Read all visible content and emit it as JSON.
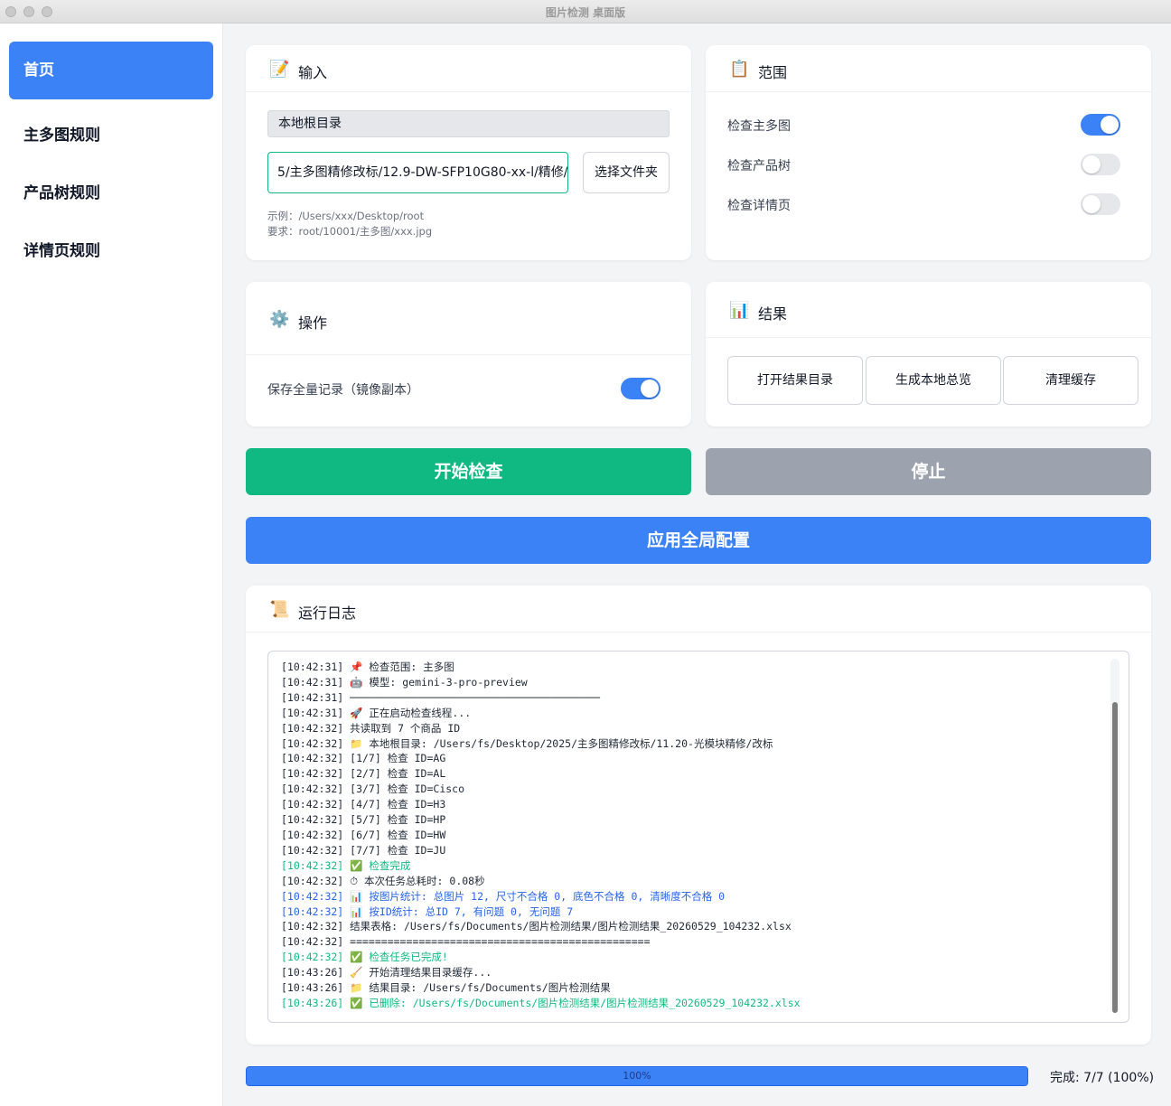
{
  "window": {
    "title": "图片检测 桌面版"
  },
  "sidebar": {
    "items": [
      {
        "label": "首页",
        "active": true
      },
      {
        "label": "主多图规则"
      },
      {
        "label": "产品树规则"
      },
      {
        "label": "详情页规则"
      }
    ]
  },
  "input_card": {
    "icon": "memo-icon",
    "title": "输入",
    "root_label": "本地根目录",
    "path_value": "5/主多图精修改标/12.9-DW-SFP10G80-xx-l/精修/",
    "choose_button": "选择文件夹",
    "hint_example": "示例：/Users/xxx/Desktop/root",
    "hint_requirement": "要求：root/10001/主多图/xxx.jpg"
  },
  "scope_card": {
    "icon": "clipboard-icon",
    "title": "范围",
    "options": [
      {
        "label": "检查主多图",
        "on": true
      },
      {
        "label": "检查产品树",
        "on": false
      },
      {
        "label": "检查详情页",
        "on": false
      }
    ]
  },
  "operation_card": {
    "icon": "gear-icon",
    "title": "操作",
    "save_all_label": "保存全量记录（镜像副本）",
    "save_all_on": true
  },
  "result_card": {
    "icon": "bar-chart-icon",
    "title": "结果",
    "open_dir_button": "打开结果目录",
    "generate_overview_button": "生成本地总览",
    "clear_cache_button": "清理缓存"
  },
  "actions": {
    "start_button": "开始检查",
    "stop_button": "停止",
    "apply_button": "应用全局配置"
  },
  "colors": {
    "start": "#10b981",
    "stop": "#9ca3af",
    "apply": "#3b82f6",
    "accent": "#3b82f6",
    "log_success": "#10b981",
    "log_stats": "#2563eb"
  },
  "log_card": {
    "icon": "scroll-icon",
    "title": "运行日志",
    "lines": [
      {
        "text": "[10:42:31] 📌 检查范围: 主多图"
      },
      {
        "text": "[10:42:31] 🤖 模型: gemini-3-pro-preview"
      },
      {
        "text": "[10:42:31] ────────────────────────────────────────"
      },
      {
        "text": "[10:42:31] 🚀 正在启动检查线程..."
      },
      {
        "text": "[10:42:32] 共读取到 7 个商品 ID"
      },
      {
        "text": "[10:42:32] 📁 本地根目录: /Users/fs/Desktop/2025/主多图精修改标/11.20-光模块精修/改标"
      },
      {
        "text": "[10:42:32] [1/7] 检查 ID=AG"
      },
      {
        "text": "[10:42:32] [2/7] 检查 ID=AL"
      },
      {
        "text": "[10:42:32] [3/7] 检查 ID=Cisco"
      },
      {
        "text": "[10:42:32] [4/7] 检查 ID=H3"
      },
      {
        "text": "[10:42:32] [5/7] 检查 ID=HP"
      },
      {
        "text": "[10:42:32] [6/7] 检查 ID=HW"
      },
      {
        "text": "[10:42:32] [7/7] 检查 ID=JU"
      },
      {
        "text": "[10:42:32] ✅ 检查完成",
        "color": "green"
      },
      {
        "text": "[10:42:32] ⏱ 本次任务总耗时: 0.08秒"
      },
      {
        "text": "[10:42:32] 📊 按图片统计: 总图片 12, 尺寸不合格 0, 底色不合格 0, 清晰度不合格 0",
        "color": "blue"
      },
      {
        "text": "[10:42:32] 📊 按ID统计: 总ID 7, 有问题 0, 无问题 7",
        "color": "blue"
      },
      {
        "text": "[10:42:32] 结果表格: /Users/fs/Documents/图片检测结果/图片检测结果_20260529_104232.xlsx"
      },
      {
        "text": "[10:42:32] ================================================"
      },
      {
        "text": "[10:42:32] ✅ 检查任务已完成!",
        "color": "green"
      },
      {
        "text": "[10:43:26] 🧹 开始清理结果目录缓存..."
      },
      {
        "text": "[10:43:26] 📁 结果目录: /Users/fs/Documents/图片检测结果"
      },
      {
        "text": "[10:43:26] ✅ 已删除: /Users/fs/Documents/图片检测结果/图片检测结果_20260529_104232.xlsx",
        "color": "green"
      }
    ]
  },
  "progress": {
    "percent_text": "100%",
    "value": 1.0,
    "status_text": "完成: 7/7 (100%)"
  }
}
